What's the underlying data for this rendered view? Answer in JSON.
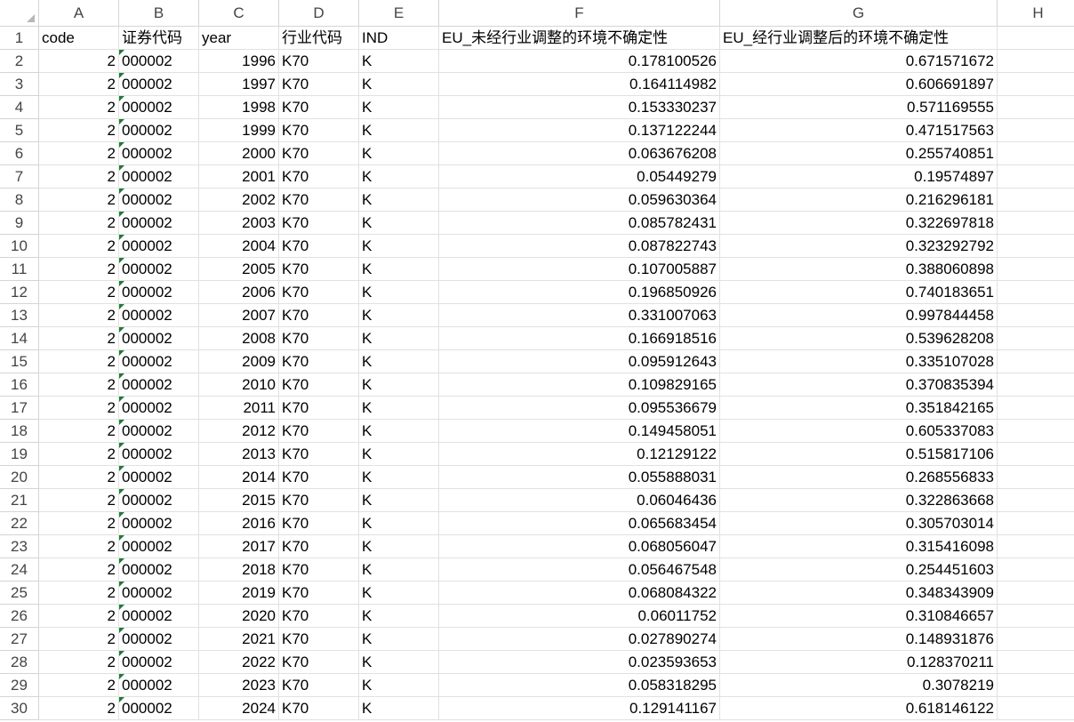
{
  "columns": [
    "A",
    "B",
    "C",
    "D",
    "E",
    "F",
    "G",
    "H"
  ],
  "header_row": {
    "row_number": "1",
    "values": [
      "code",
      "证券代码",
      "year",
      "行业代码",
      "IND",
      "EU_未经行业调整的环境不确定性",
      "EU_经行业调整后的环境不确定性",
      ""
    ]
  },
  "rows": [
    {
      "n": "2",
      "code": "2",
      "sec": "000002",
      "year": "1996",
      "indcode": "K70",
      "ind": "K",
      "f": "0.178100526",
      "g": "0.671571672"
    },
    {
      "n": "3",
      "code": "2",
      "sec": "000002",
      "year": "1997",
      "indcode": "K70",
      "ind": "K",
      "f": "0.164114982",
      "g": "0.606691897"
    },
    {
      "n": "4",
      "code": "2",
      "sec": "000002",
      "year": "1998",
      "indcode": "K70",
      "ind": "K",
      "f": "0.153330237",
      "g": "0.571169555"
    },
    {
      "n": "5",
      "code": "2",
      "sec": "000002",
      "year": "1999",
      "indcode": "K70",
      "ind": "K",
      "f": "0.137122244",
      "g": "0.471517563"
    },
    {
      "n": "6",
      "code": "2",
      "sec": "000002",
      "year": "2000",
      "indcode": "K70",
      "ind": "K",
      "f": "0.063676208",
      "g": "0.255740851"
    },
    {
      "n": "7",
      "code": "2",
      "sec": "000002",
      "year": "2001",
      "indcode": "K70",
      "ind": "K",
      "f": "0.05449279",
      "g": "0.19574897"
    },
    {
      "n": "8",
      "code": "2",
      "sec": "000002",
      "year": "2002",
      "indcode": "K70",
      "ind": "K",
      "f": "0.059630364",
      "g": "0.216296181"
    },
    {
      "n": "9",
      "code": "2",
      "sec": "000002",
      "year": "2003",
      "indcode": "K70",
      "ind": "K",
      "f": "0.085782431",
      "g": "0.322697818"
    },
    {
      "n": "10",
      "code": "2",
      "sec": "000002",
      "year": "2004",
      "indcode": "K70",
      "ind": "K",
      "f": "0.087822743",
      "g": "0.323292792"
    },
    {
      "n": "11",
      "code": "2",
      "sec": "000002",
      "year": "2005",
      "indcode": "K70",
      "ind": "K",
      "f": "0.107005887",
      "g": "0.388060898"
    },
    {
      "n": "12",
      "code": "2",
      "sec": "000002",
      "year": "2006",
      "indcode": "K70",
      "ind": "K",
      "f": "0.196850926",
      "g": "0.740183651"
    },
    {
      "n": "13",
      "code": "2",
      "sec": "000002",
      "year": "2007",
      "indcode": "K70",
      "ind": "K",
      "f": "0.331007063",
      "g": "0.997844458"
    },
    {
      "n": "14",
      "code": "2",
      "sec": "000002",
      "year": "2008",
      "indcode": "K70",
      "ind": "K",
      "f": "0.166918516",
      "g": "0.539628208"
    },
    {
      "n": "15",
      "code": "2",
      "sec": "000002",
      "year": "2009",
      "indcode": "K70",
      "ind": "K",
      "f": "0.095912643",
      "g": "0.335107028"
    },
    {
      "n": "16",
      "code": "2",
      "sec": "000002",
      "year": "2010",
      "indcode": "K70",
      "ind": "K",
      "f": "0.109829165",
      "g": "0.370835394"
    },
    {
      "n": "17",
      "code": "2",
      "sec": "000002",
      "year": "2011",
      "indcode": "K70",
      "ind": "K",
      "f": "0.095536679",
      "g": "0.351842165"
    },
    {
      "n": "18",
      "code": "2",
      "sec": "000002",
      "year": "2012",
      "indcode": "K70",
      "ind": "K",
      "f": "0.149458051",
      "g": "0.605337083"
    },
    {
      "n": "19",
      "code": "2",
      "sec": "000002",
      "year": "2013",
      "indcode": "K70",
      "ind": "K",
      "f": "0.12129122",
      "g": "0.515817106"
    },
    {
      "n": "20",
      "code": "2",
      "sec": "000002",
      "year": "2014",
      "indcode": "K70",
      "ind": "K",
      "f": "0.055888031",
      "g": "0.268556833"
    },
    {
      "n": "21",
      "code": "2",
      "sec": "000002",
      "year": "2015",
      "indcode": "K70",
      "ind": "K",
      "f": "0.06046436",
      "g": "0.322863668"
    },
    {
      "n": "22",
      "code": "2",
      "sec": "000002",
      "year": "2016",
      "indcode": "K70",
      "ind": "K",
      "f": "0.065683454",
      "g": "0.305703014"
    },
    {
      "n": "23",
      "code": "2",
      "sec": "000002",
      "year": "2017",
      "indcode": "K70",
      "ind": "K",
      "f": "0.068056047",
      "g": "0.315416098"
    },
    {
      "n": "24",
      "code": "2",
      "sec": "000002",
      "year": "2018",
      "indcode": "K70",
      "ind": "K",
      "f": "0.056467548",
      "g": "0.254451603"
    },
    {
      "n": "25",
      "code": "2",
      "sec": "000002",
      "year": "2019",
      "indcode": "K70",
      "ind": "K",
      "f": "0.068084322",
      "g": "0.348343909"
    },
    {
      "n": "26",
      "code": "2",
      "sec": "000002",
      "year": "2020",
      "indcode": "K70",
      "ind": "K",
      "f": "0.06011752",
      "g": "0.310846657"
    },
    {
      "n": "27",
      "code": "2",
      "sec": "000002",
      "year": "2021",
      "indcode": "K70",
      "ind": "K",
      "f": "0.027890274",
      "g": "0.148931876"
    },
    {
      "n": "28",
      "code": "2",
      "sec": "000002",
      "year": "2022",
      "indcode": "K70",
      "ind": "K",
      "f": "0.023593653",
      "g": "0.128370211"
    },
    {
      "n": "29",
      "code": "2",
      "sec": "000002",
      "year": "2023",
      "indcode": "K70",
      "ind": "K",
      "f": "0.058318295",
      "g": "0.3078219"
    },
    {
      "n": "30",
      "code": "2",
      "sec": "000002",
      "year": "2024",
      "indcode": "K70",
      "ind": "K",
      "f": "0.129141167",
      "g": "0.618146122"
    }
  ],
  "colors": {
    "grid": "#e1e1e1",
    "header_border": "#d4d4d4",
    "text_indicator": "#1e7b34"
  }
}
